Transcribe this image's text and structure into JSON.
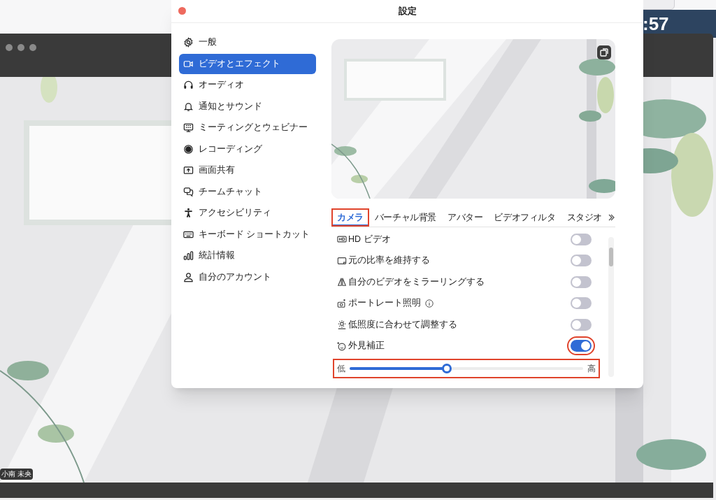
{
  "background_window": {
    "clock": ":57",
    "participant_name": "小南 未央"
  },
  "settings": {
    "title": "設定",
    "sidebar": {
      "items": [
        {
          "label": "一般",
          "selected": false
        },
        {
          "label": "ビデオとエフェクト",
          "selected": true
        },
        {
          "label": "オーディオ",
          "selected": false
        },
        {
          "label": "通知とサウンド",
          "selected": false
        },
        {
          "label": "ミーティングとウェビナー",
          "selected": false
        },
        {
          "label": "レコーディング",
          "selected": false
        },
        {
          "label": "画面共有",
          "selected": false
        },
        {
          "label": "チームチャット",
          "selected": false
        },
        {
          "label": "アクセシビリティ",
          "selected": false
        },
        {
          "label": "キーボード ショートカット",
          "selected": false
        },
        {
          "label": "統計情報",
          "selected": false
        },
        {
          "label": "自分のアカウント",
          "selected": false
        }
      ]
    },
    "tabs": [
      {
        "label": "カメラ",
        "selected": true,
        "highlighted": true
      },
      {
        "label": "バーチャル背景",
        "selected": false,
        "highlighted": false
      },
      {
        "label": "アバター",
        "selected": false,
        "highlighted": false
      },
      {
        "label": "ビデオフィルタ",
        "selected": false,
        "highlighted": false
      },
      {
        "label": "スタジオ",
        "selected": false,
        "highlighted": false
      }
    ],
    "options": [
      {
        "kind": "toggle",
        "label": "HD ビデオ",
        "on": false,
        "highlighted": false
      },
      {
        "kind": "toggle",
        "label": "元の比率を維持する",
        "on": false,
        "highlighted": false
      },
      {
        "kind": "toggle",
        "label": "自分のビデオをミラーリングする",
        "on": false,
        "highlighted": false
      },
      {
        "kind": "toggle",
        "label": "ポートレート照明",
        "info": true,
        "on": false,
        "highlighted": false
      },
      {
        "kind": "toggle",
        "label": "低照度に合わせて調整する",
        "on": false,
        "highlighted": false
      },
      {
        "kind": "toggle",
        "label": "外見補正",
        "on": true,
        "highlighted": true
      },
      {
        "kind": "slider",
        "min_label": "低",
        "max_label": "高",
        "level": 0.415,
        "highlighted": true
      }
    ]
  }
}
